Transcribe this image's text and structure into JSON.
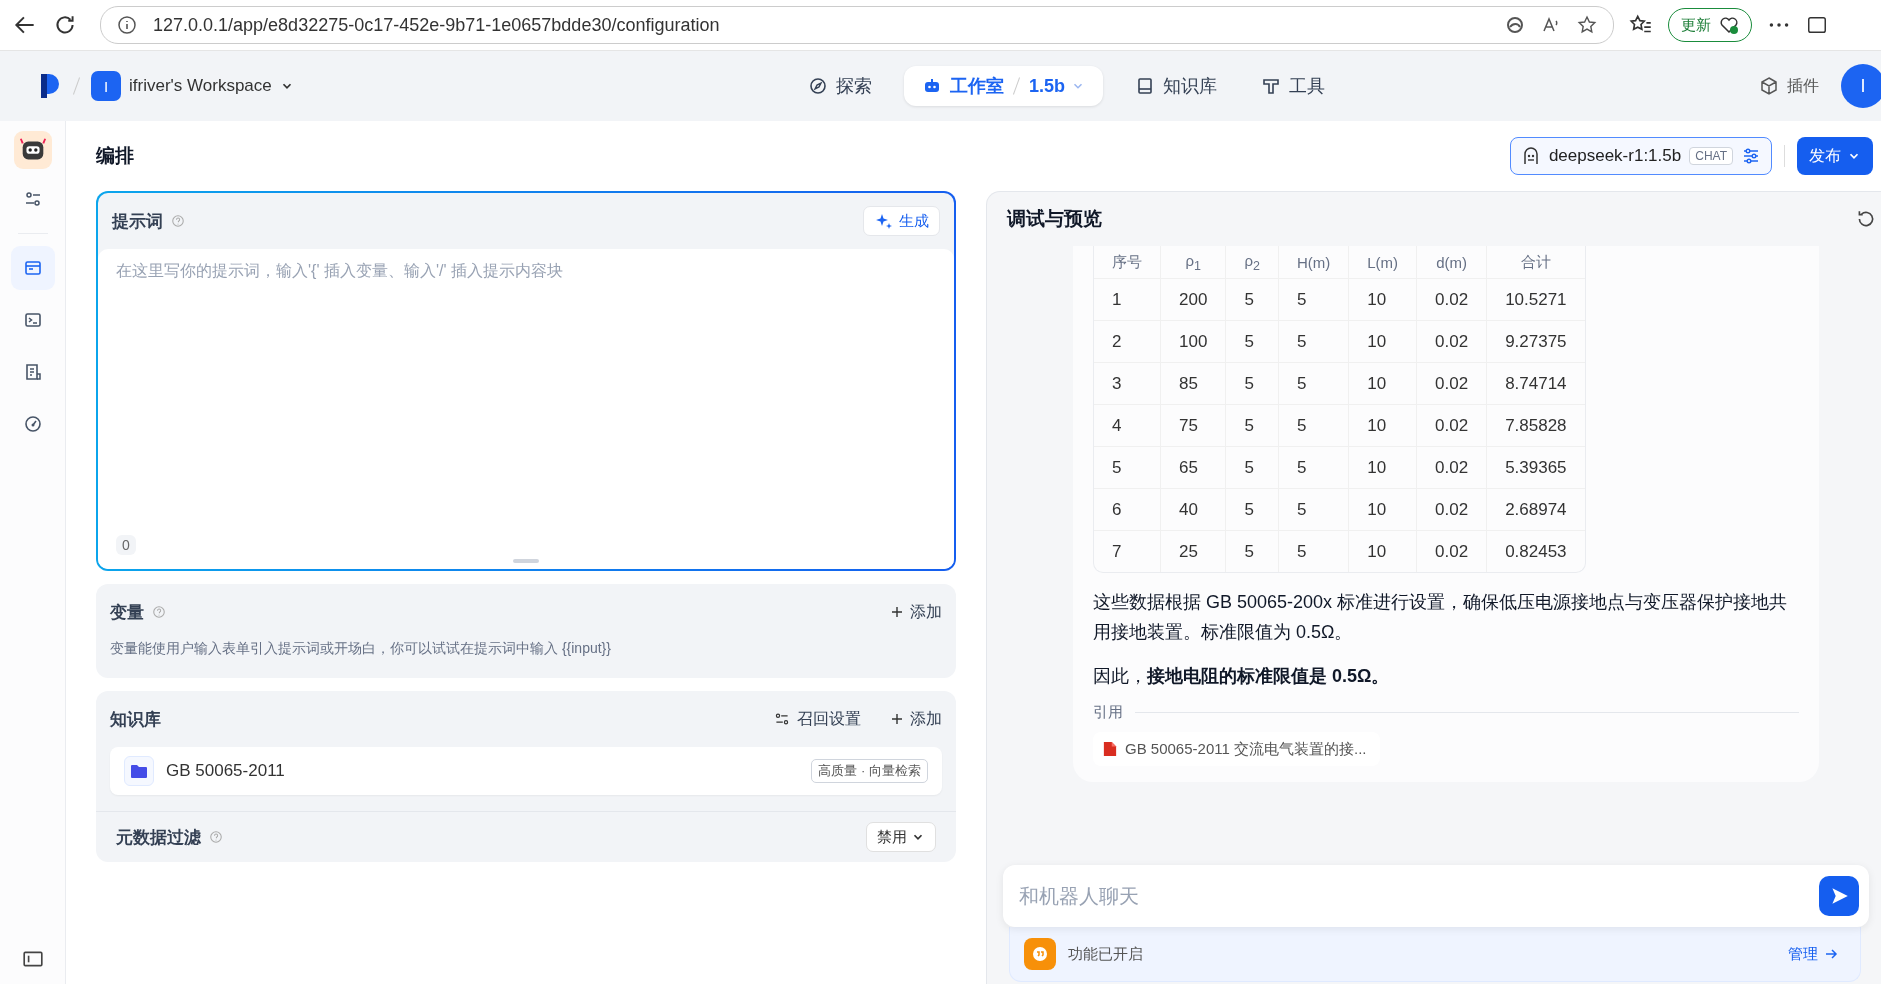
{
  "browser": {
    "url": "127.0.0.1/app/e8d32275-0c17-452e-9b71-1e0657bdde30/configuration",
    "update_button": "更新"
  },
  "nav": {
    "workspace_initial": "I",
    "workspace": "ifriver's Workspace",
    "tabs": [
      {
        "kind": "explore",
        "label": "探索",
        "selected": false
      },
      {
        "kind": "studio",
        "label": "工作室",
        "selected": true,
        "app": "1.5b"
      },
      {
        "kind": "knowledge",
        "label": "知识库",
        "selected": false
      },
      {
        "kind": "tools",
        "label": "工具",
        "selected": false
      }
    ],
    "plugins": "插件",
    "avatar": "I"
  },
  "sidebar": {
    "items": [
      {
        "kind": "settings",
        "selected": false
      },
      {
        "kind": "orchestrate",
        "selected": true
      },
      {
        "kind": "terminal",
        "selected": false
      },
      {
        "kind": "logs",
        "selected": false
      },
      {
        "kind": "monitor",
        "selected": false
      }
    ]
  },
  "page": {
    "title": "编排",
    "model": {
      "name": "deepseek-r1:1.5b",
      "mode": "CHAT"
    },
    "publish": "发布"
  },
  "prompt": {
    "title": "提示词",
    "generate": "生成",
    "placeholder": "在这里写你的提示词，输入'{' 插入变量、输入'/' 插入提示内容块",
    "count": "0"
  },
  "variables": {
    "title": "变量",
    "add": "添加",
    "hint": "变量能使用户输入表单引入提示词或开场白，你可以试试在提示词中输入 {{input}}"
  },
  "knowledge": {
    "title": "知识库",
    "recall": "召回设置",
    "add": "添加",
    "datasets": [
      {
        "name": "GB 50065-2011",
        "tag": "高质量 · 向量检索"
      }
    ]
  },
  "metadata_filter": {
    "title": "元数据过滤",
    "value": "禁用"
  },
  "preview": {
    "title": "调试与预览",
    "table": {
      "columns": [
        "序号",
        "ρ$_{1}$",
        "ρ$_{2}$",
        "H(m)",
        "L(m)",
        "d(m)",
        "合计"
      ],
      "rows": [
        [
          "1",
          "200",
          "5",
          "5",
          "10",
          "0.02",
          "10.5271"
        ],
        [
          "2",
          "100",
          "5",
          "5",
          "10",
          "0.02",
          "9.27375"
        ],
        [
          "3",
          "85",
          "5",
          "5",
          "10",
          "0.02",
          "8.74714"
        ],
        [
          "4",
          "75",
          "5",
          "5",
          "10",
          "0.02",
          "7.85828"
        ],
        [
          "5",
          "65",
          "5",
          "5",
          "10",
          "0.02",
          "5.39365"
        ],
        [
          "6",
          "40",
          "5",
          "5",
          "10",
          "0.02",
          "2.68974"
        ],
        [
          "7",
          "25",
          "5",
          "5",
          "10",
          "0.02",
          "0.82453"
        ]
      ]
    },
    "paragraphs": [
      "这些数据根据 GB 50065-200x 标准进行设置，确保低压电源接地点与变压器保护接地共用接地装置。标准限值为 0.5Ω。",
      "因此，**接地电阻的标准限值是 0.5Ω。**"
    ],
    "citation_label": "引用",
    "citations": [
      "GB 50065-2011 交流电气装置的接..."
    ]
  },
  "chat": {
    "placeholder": "和机器人聊天",
    "features": "功能已开启",
    "manage": "管理"
  }
}
